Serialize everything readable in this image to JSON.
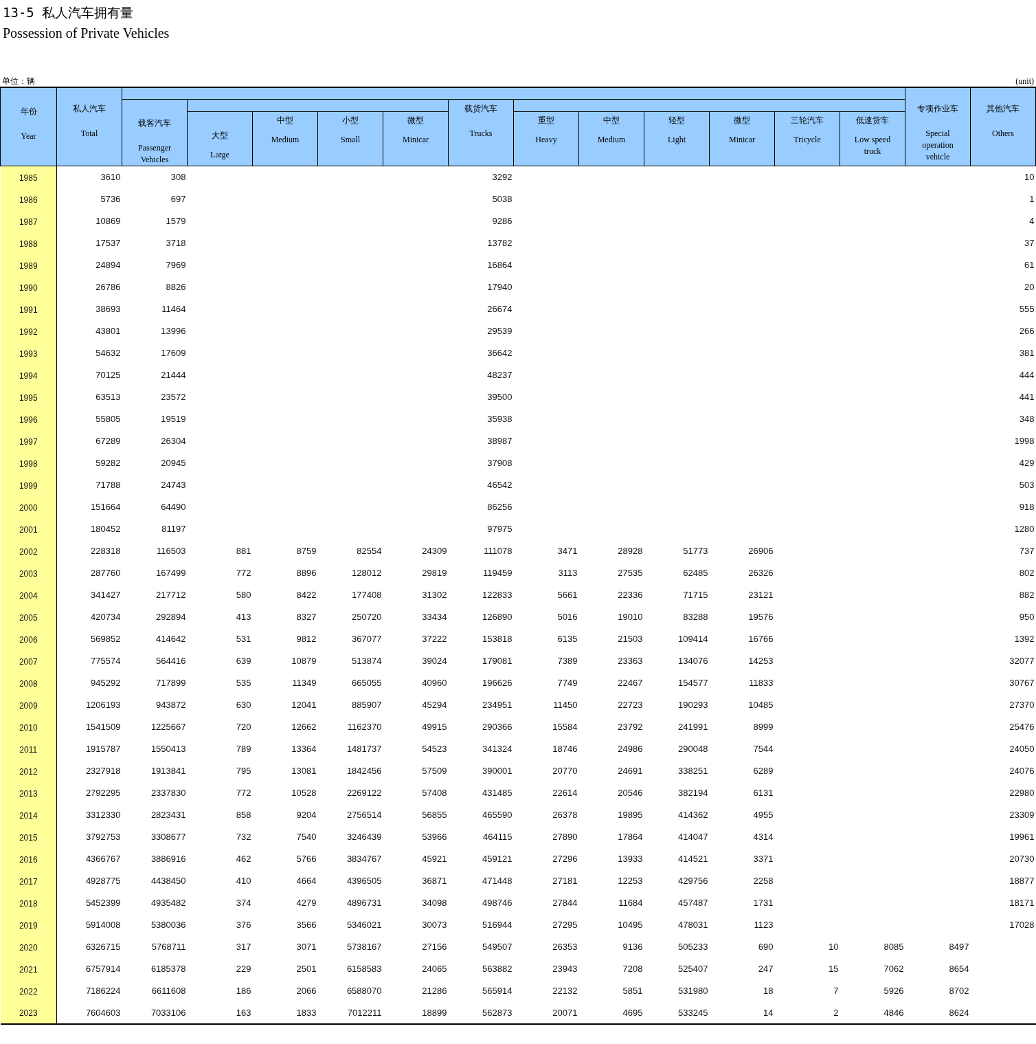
{
  "title": "13-5 私人汽车拥有量",
  "subtitle": "Possession of Private Vehicles",
  "unit_label": "单位：辆",
  "unit_note": "(unit)",
  "columns": [
    {
      "kind": "top",
      "cn": "年份",
      "en": "Year"
    },
    {
      "kind": "top",
      "cn": "私人汽车",
      "en": "Total"
    },
    {
      "kind": "group",
      "cn": "载客汽车",
      "en": "Passenger Vehicles"
    },
    {
      "kind": "sub",
      "cn": "大型",
      "en": "Large"
    },
    {
      "kind": "sub",
      "cn": "中型",
      "en": "Medium"
    },
    {
      "kind": "sub",
      "cn": "小型",
      "en": "Small"
    },
    {
      "kind": "sub",
      "cn": "微型",
      "en": "Minicar"
    },
    {
      "kind": "group",
      "cn": "载货汽车",
      "en": "Trucks"
    },
    {
      "kind": "sub",
      "cn": "重型",
      "en": "Heavy"
    },
    {
      "kind": "sub",
      "cn": "中型",
      "en": "Medium"
    },
    {
      "kind": "sub",
      "cn": "轻型",
      "en": "Light"
    },
    {
      "kind": "sub",
      "cn": "微型",
      "en": "Minicar"
    },
    {
      "kind": "sub",
      "cn": "三轮汽车",
      "en": "Tricycle"
    },
    {
      "kind": "sub",
      "cn": "低速货车",
      "en": "Low speed truck"
    },
    {
      "kind": "top",
      "cn": "专项作业车",
      "en": "Special operation vehicle"
    },
    {
      "kind": "top",
      "cn": "其他汽车",
      "en": "Others"
    }
  ],
  "rows": [
    {
      "year": "1985",
      "cells": [
        "3610",
        "308",
        null,
        null,
        null,
        null,
        "3292",
        null,
        null,
        null,
        null,
        null,
        null,
        null,
        "10"
      ]
    },
    {
      "year": "1986",
      "cells": [
        "5736",
        "697",
        null,
        null,
        null,
        null,
        "5038",
        null,
        null,
        null,
        null,
        null,
        null,
        null,
        "1"
      ]
    },
    {
      "year": "1987",
      "cells": [
        "10869",
        "1579",
        null,
        null,
        null,
        null,
        "9286",
        null,
        null,
        null,
        null,
        null,
        null,
        null,
        "4"
      ]
    },
    {
      "year": "1988",
      "cells": [
        "17537",
        "3718",
        null,
        null,
        null,
        null,
        "13782",
        null,
        null,
        null,
        null,
        null,
        null,
        null,
        "37"
      ]
    },
    {
      "year": "1989",
      "cells": [
        "24894",
        "7969",
        null,
        null,
        null,
        null,
        "16864",
        null,
        null,
        null,
        null,
        null,
        null,
        null,
        "61"
      ]
    },
    {
      "year": "1990",
      "cells": [
        "26786",
        "8826",
        null,
        null,
        null,
        null,
        "17940",
        null,
        null,
        null,
        null,
        null,
        null,
        null,
        "20"
      ]
    },
    {
      "year": "1991",
      "cells": [
        "38693",
        "11464",
        null,
        null,
        null,
        null,
        "26674",
        null,
        null,
        null,
        null,
        null,
        null,
        null,
        "555"
      ]
    },
    {
      "year": "1992",
      "cells": [
        "43801",
        "13996",
        null,
        null,
        null,
        null,
        "29539",
        null,
        null,
        null,
        null,
        null,
        null,
        null,
        "266"
      ]
    },
    {
      "year": "1993",
      "cells": [
        "54632",
        "17609",
        null,
        null,
        null,
        null,
        "36642",
        null,
        null,
        null,
        null,
        null,
        null,
        null,
        "381"
      ]
    },
    {
      "year": "1994",
      "cells": [
        "70125",
        "21444",
        null,
        null,
        null,
        null,
        "48237",
        null,
        null,
        null,
        null,
        null,
        null,
        null,
        "444"
      ]
    },
    {
      "year": "1995",
      "cells": [
        "63513",
        "23572",
        null,
        null,
        null,
        null,
        "39500",
        null,
        null,
        null,
        null,
        null,
        null,
        null,
        "441"
      ]
    },
    {
      "year": "1996",
      "cells": [
        "55805",
        "19519",
        null,
        null,
        null,
        null,
        "35938",
        null,
        null,
        null,
        null,
        null,
        null,
        null,
        "348"
      ]
    },
    {
      "year": "1997",
      "cells": [
        "67289",
        "26304",
        null,
        null,
        null,
        null,
        "38987",
        null,
        null,
        null,
        null,
        null,
        null,
        null,
        "1998"
      ]
    },
    {
      "year": "1998",
      "cells": [
        "59282",
        "20945",
        null,
        null,
        null,
        null,
        "37908",
        null,
        null,
        null,
        null,
        null,
        null,
        null,
        "429"
      ]
    },
    {
      "year": "1999",
      "cells": [
        "71788",
        "24743",
        null,
        null,
        null,
        null,
        "46542",
        null,
        null,
        null,
        null,
        null,
        null,
        null,
        "503"
      ]
    },
    {
      "year": "2000",
      "cells": [
        "151664",
        "64490",
        null,
        null,
        null,
        null,
        "86256",
        null,
        null,
        null,
        null,
        null,
        null,
        null,
        "918"
      ]
    },
    {
      "year": "2001",
      "cells": [
        "180452",
        "81197",
        null,
        null,
        null,
        null,
        "97975",
        null,
        null,
        null,
        null,
        null,
        null,
        null,
        "1280"
      ]
    },
    {
      "year": "2002",
      "cells": [
        "228318",
        "116503",
        "881",
        "8759",
        "82554",
        "24309",
        "111078",
        "3471",
        "28928",
        "51773",
        "26906",
        null,
        null,
        null,
        "737"
      ]
    },
    {
      "year": "2003",
      "cells": [
        "287760",
        "167499",
        "772",
        "8896",
        "128012",
        "29819",
        "119459",
        "3113",
        "27535",
        "62485",
        "26326",
        null,
        null,
        null,
        "802"
      ]
    },
    {
      "year": "2004",
      "cells": [
        "341427",
        "217712",
        "580",
        "8422",
        "177408",
        "31302",
        "122833",
        "5661",
        "22336",
        "71715",
        "23121",
        null,
        null,
        null,
        "882"
      ]
    },
    {
      "year": "2005",
      "cells": [
        "420734",
        "292894",
        "413",
        "8327",
        "250720",
        "33434",
        "126890",
        "5016",
        "19010",
        "83288",
        "19576",
        null,
        null,
        null,
        "950"
      ]
    },
    {
      "year": "2006",
      "cells": [
        "569852",
        "414642",
        "531",
        "9812",
        "367077",
        "37222",
        "153818",
        "6135",
        "21503",
        "109414",
        "16766",
        null,
        null,
        null,
        "1392"
      ]
    },
    {
      "year": "2007",
      "cells": [
        "775574",
        "564416",
        "639",
        "10879",
        "513874",
        "39024",
        "179081",
        "7389",
        "23363",
        "134076",
        "14253",
        null,
        null,
        null,
        "32077"
      ]
    },
    {
      "year": "2008",
      "cells": [
        "945292",
        "717899",
        "535",
        "11349",
        "665055",
        "40960",
        "196626",
        "7749",
        "22467",
        "154577",
        "11833",
        null,
        null,
        null,
        "30767"
      ]
    },
    {
      "year": "2009",
      "cells": [
        "1206193",
        "943872",
        "630",
        "12041",
        "885907",
        "45294",
        "234951",
        "11450",
        "22723",
        "190293",
        "10485",
        null,
        null,
        null,
        "27370"
      ]
    },
    {
      "year": "2010",
      "cells": [
        "1541509",
        "1225667",
        "720",
        "12662",
        "1162370",
        "49915",
        "290366",
        "15584",
        "23792",
        "241991",
        "8999",
        null,
        null,
        null,
        "25476"
      ]
    },
    {
      "year": "2011",
      "cells": [
        "1915787",
        "1550413",
        "789",
        "13364",
        "1481737",
        "54523",
        "341324",
        "18746",
        "24986",
        "290048",
        "7544",
        null,
        null,
        null,
        "24050"
      ]
    },
    {
      "year": "2012",
      "cells": [
        "2327918",
        "1913841",
        "795",
        "13081",
        "1842456",
        "57509",
        "390001",
        "20770",
        "24691",
        "338251",
        "6289",
        null,
        null,
        null,
        "24076"
      ]
    },
    {
      "year": "2013",
      "cells": [
        "2792295",
        "2337830",
        "772",
        "10528",
        "2269122",
        "57408",
        "431485",
        "22614",
        "20546",
        "382194",
        "6131",
        null,
        null,
        null,
        "22980"
      ]
    },
    {
      "year": "2014",
      "cells": [
        "3312330",
        "2823431",
        "858",
        "9204",
        "2756514",
        "56855",
        "465590",
        "26378",
        "19895",
        "414362",
        "4955",
        null,
        null,
        null,
        "23309"
      ]
    },
    {
      "year": "2015",
      "cells": [
        "3792753",
        "3308677",
        "732",
        "7540",
        "3246439",
        "53966",
        "464115",
        "27890",
        "17864",
        "414047",
        "4314",
        null,
        null,
        null,
        "19961"
      ]
    },
    {
      "year": "2016",
      "cells": [
        "4366767",
        "3886916",
        "462",
        "5766",
        "3834767",
        "45921",
        "459121",
        "27296",
        "13933",
        "414521",
        "3371",
        null,
        null,
        null,
        "20730"
      ]
    },
    {
      "year": "2017",
      "cells": [
        "4928775",
        "4438450",
        "410",
        "4664",
        "4396505",
        "36871",
        "471448",
        "27181",
        "12253",
        "429756",
        "2258",
        null,
        null,
        null,
        "18877"
      ]
    },
    {
      "year": "2018",
      "cells": [
        "5452399",
        "4935482",
        "374",
        "4279",
        "4896731",
        "34098",
        "498746",
        "27844",
        "11684",
        "457487",
        "1731",
        null,
        null,
        null,
        "18171"
      ]
    },
    {
      "year": "2019",
      "cells": [
        "5914008",
        "5380036",
        "376",
        "3566",
        "5346021",
        "30073",
        "516944",
        "27295",
        "10495",
        "478031",
        "1123",
        null,
        null,
        null,
        "17028"
      ]
    },
    {
      "year": "2020",
      "cells": [
        "6326715",
        "5768711",
        "317",
        "3071",
        "5738167",
        "27156",
        "549507",
        "26353",
        "9136",
        "505233",
        "690",
        "10",
        "8085",
        "8497",
        null
      ]
    },
    {
      "year": "2021",
      "cells": [
        "6757914",
        "6185378",
        "229",
        "2501",
        "6158583",
        "24065",
        "563882",
        "23943",
        "7208",
        "525407",
        "247",
        "15",
        "7062",
        "8654",
        null
      ]
    },
    {
      "year": "2022",
      "cells": [
        "7186224",
        "6611608",
        "186",
        "2066",
        "6588070",
        "21286",
        "565914",
        "22132",
        "5851",
        "531980",
        "18",
        "7",
        "5926",
        "8702",
        null
      ]
    },
    {
      "year": "2023",
      "cells": [
        "7604603",
        "7033106",
        "163",
        "1833",
        "7012211",
        "18899",
        "562873",
        "20071",
        "4695",
        "533245",
        "14",
        "2",
        "4846",
        "8624",
        null
      ]
    }
  ]
}
